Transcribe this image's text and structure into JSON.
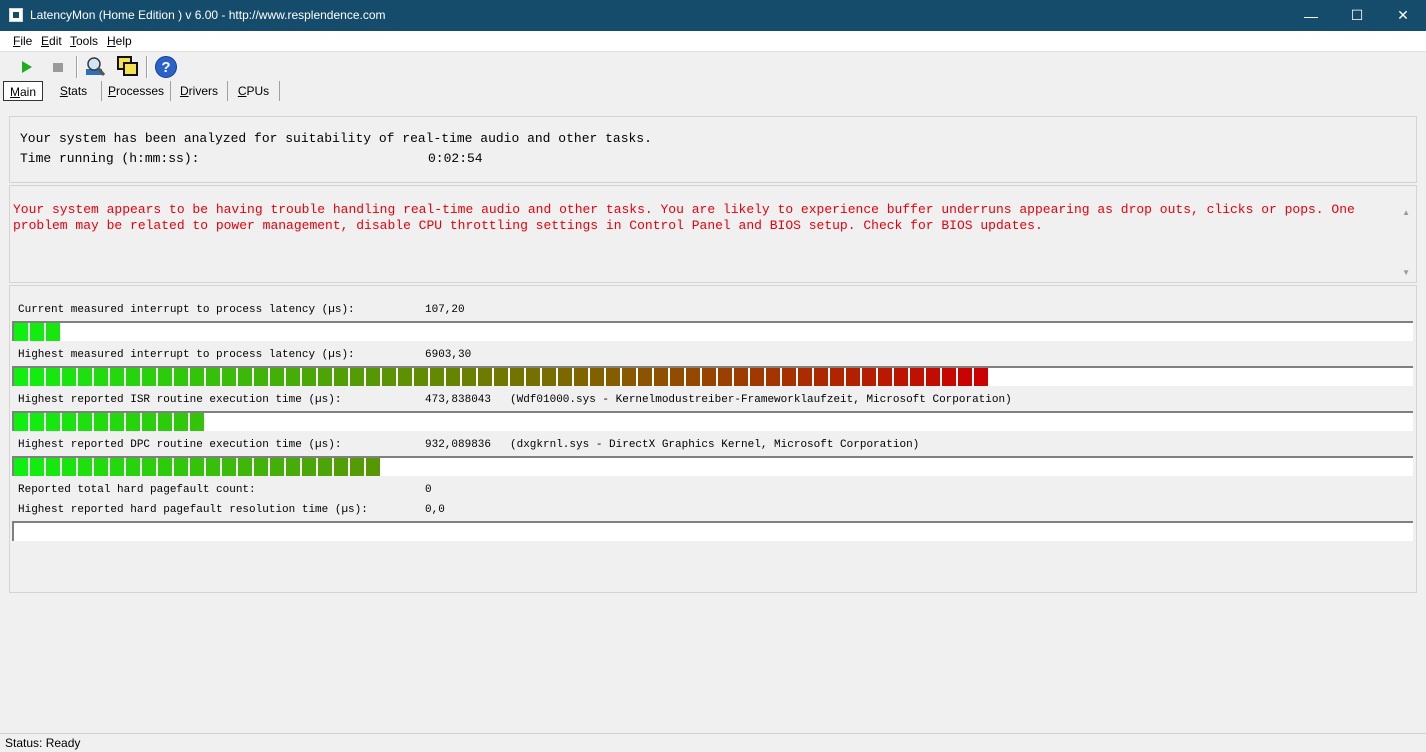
{
  "window": {
    "title": "LatencyMon  (Home Edition )  v 6.00 - http://www.resplendence.com",
    "minimize_glyph": "—",
    "maximize_glyph": "☐",
    "close_glyph": "✕"
  },
  "menu": [
    {
      "u": "F",
      "rest": "ile"
    },
    {
      "u": "E",
      "rest": "dit"
    },
    {
      "u": "T",
      "rest": "ools"
    },
    {
      "u": "H",
      "rest": "elp"
    }
  ],
  "toolbar": {
    "icons": [
      "play-icon",
      "stop-icon",
      "analyze-icon",
      "windows-icon",
      "help-icon"
    ],
    "colors": {
      "play": "#1fae1f",
      "stop": "#9a9a9a",
      "help": "#2a62c9"
    }
  },
  "tabs": [
    {
      "u": "M",
      "rest": "ain",
      "active": true
    },
    {
      "u": "S",
      "rest": "tats",
      "active": false
    },
    {
      "u": "P",
      "rest": "rocesses",
      "active": false
    },
    {
      "u": "D",
      "rest": "rivers",
      "active": false
    },
    {
      "u": "C",
      "rest": "PUs",
      "active": false
    }
  ],
  "summary": {
    "line1": "Your system has been analyzed for suitability of real-time audio and other tasks.",
    "time_label": "Time running (h:mm:ss):",
    "time_value": "0:02:54"
  },
  "warning": {
    "text": "Your system appears to be having trouble handling real-time audio and other tasks. You are likely to experience buffer underruns appearing as drop outs, clicks or pops. One problem may be related to power management, disable CPU throttling settings in Control Panel and BIOS setup. Check for BIOS updates.",
    "color": "#e8000b"
  },
  "metrics": [
    {
      "label": "Current measured interrupt to process latency (µs):",
      "value": "107,20",
      "desc": "",
      "segments": 3
    },
    {
      "label": "Highest measured interrupt to process latency (µs):",
      "value": "6903,30",
      "desc": "",
      "segments": 61
    },
    {
      "label": "Highest reported ISR routine execution time (µs):",
      "value": "473,838043",
      "desc": "(Wdf01000.sys - Kernelmodustreiber-Frameworklaufzeit, Microsoft Corporation)",
      "segments": 12
    },
    {
      "label": "Highest reported DPC routine execution time (µs):",
      "value": "932,089836",
      "desc": "(dxgkrnl.sys - DirectX Graphics Kernel, Microsoft Corporation)",
      "segments": 23
    },
    {
      "label": "Reported total hard pagefault count:",
      "value": "0",
      "desc": ""
    },
    {
      "label": "Highest reported hard pagefault resolution time (µs):",
      "value": "0,0",
      "desc": "",
      "segments": 0
    }
  ],
  "status": {
    "text": "Status: Ready"
  }
}
